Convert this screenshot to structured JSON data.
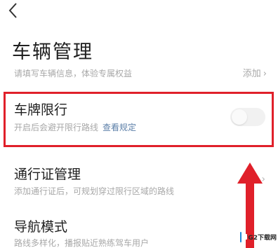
{
  "header": {
    "back_icon": "chevron-left-icon",
    "title": "车辆管理"
  },
  "vehicle": {
    "subtitle": "请填写车辆信息，体验专属权益",
    "add_label": "添加",
    "add_chevron": "›"
  },
  "plate_limit": {
    "title": "车牌限行",
    "description": "开启后会避开限行路线",
    "rules_link": "查看规定",
    "toggle_on": false,
    "highlight_color": "#e0202a"
  },
  "pass": {
    "title": "通行证管理",
    "description": "添加通行证后，可规划穿过限行区域的路线",
    "chevron": "›"
  },
  "nav_mode": {
    "title": "导航模式",
    "description": "路线多样化，播报贴近熟练驾车用户"
  },
  "annotation": {
    "arrow_color": "#e0202a",
    "arrow_direction": "up"
  },
  "watermark": {
    "text": "7G2下载网"
  }
}
